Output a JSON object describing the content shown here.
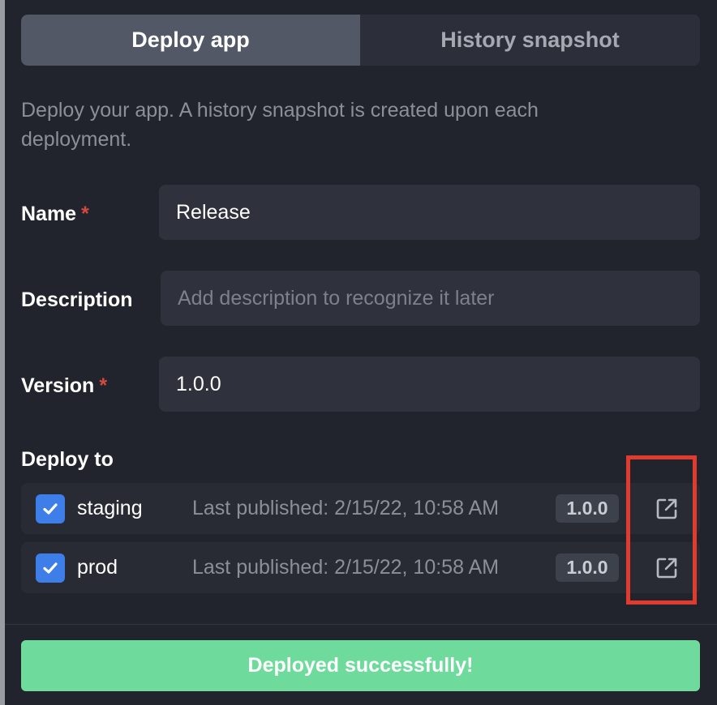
{
  "tabs": [
    {
      "label": "Deploy app",
      "active": true
    },
    {
      "label": "History snapshot",
      "active": false
    }
  ],
  "intro_text": "Deploy your app. A history snapshot is created upon each deployment.",
  "form": {
    "name": {
      "label": "Name",
      "required_marker": "*",
      "value": "Release"
    },
    "description": {
      "label": "Description",
      "placeholder": "Add description to recognize it later",
      "value": ""
    },
    "version": {
      "label": "Version",
      "required_marker": "*",
      "value": "1.0.0"
    }
  },
  "deploy_to": {
    "title": "Deploy to",
    "environments": [
      {
        "name": "staging",
        "checked": true,
        "last_published": "Last published: 2/15/22, 10:58 AM",
        "version": "1.0.0",
        "icon": "external-link-icon"
      },
      {
        "name": "prod",
        "checked": true,
        "last_published": "Last published: 2/15/22, 10:58 AM",
        "version": "1.0.0",
        "icon": "external-link-icon"
      }
    ]
  },
  "footer": {
    "button_label": "Deployed successfully!"
  },
  "colors": {
    "panel_bg": "#22242d",
    "accent_blue": "#3d7ee8",
    "success_green": "#6edb9c",
    "required_red": "#d64a3e",
    "highlight_red": "#e03b2e"
  }
}
